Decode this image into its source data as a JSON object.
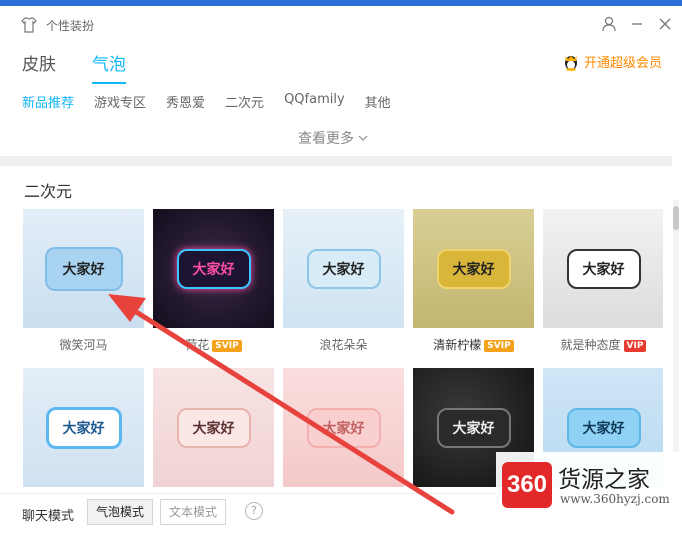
{
  "window": {
    "title": "个性装扮"
  },
  "tabs": [
    {
      "label": "皮肤",
      "active": false
    },
    {
      "label": "气泡",
      "active": true
    }
  ],
  "vip_link": {
    "label": "开通超级会员"
  },
  "subnav": [
    {
      "label": "新品推荐",
      "active": true
    },
    {
      "label": "游戏专区",
      "active": false
    },
    {
      "label": "秀恩爱",
      "active": false
    },
    {
      "label": "二次元",
      "active": false
    },
    {
      "label": "QQfamily",
      "active": false
    },
    {
      "label": "其他",
      "active": false
    }
  ],
  "more_label": "查看更多",
  "section_title": "二次元",
  "bubbles": [
    {
      "text": "大家好",
      "name": "微笑河马",
      "badge": ""
    },
    {
      "text": "大家好",
      "name": "荷花",
      "badge": "SVIP"
    },
    {
      "text": "大家好",
      "name": "浪花朵朵",
      "badge": ""
    },
    {
      "text": "大家好",
      "name": "清新柠檬",
      "badge": "SVIP"
    },
    {
      "text": "大家好",
      "name": "就是种态度",
      "badge": "VIP"
    },
    {
      "text": "大家好",
      "name": "",
      "badge": ""
    },
    {
      "text": "大家好",
      "name": "",
      "badge": ""
    },
    {
      "text": "大家好",
      "name": "",
      "badge": ""
    },
    {
      "text": "大家好",
      "name": "",
      "badge": ""
    },
    {
      "text": "大家好",
      "name": "",
      "badge": ""
    }
  ],
  "footer": {
    "mode_label": "聊天模式",
    "bubble_mode": "气泡模式",
    "text_mode": "文本模式",
    "help": "?"
  },
  "watermark": {
    "logo": "360",
    "title": "货源之家",
    "url": "www.360hyzj.com"
  },
  "colors": {
    "accent": "#12b7f5",
    "vip_orange": "#ff8a00",
    "svip_badge": "#f5a21b",
    "vip_badge": "#e63b2e",
    "annotation_arrow": "#e8423c"
  }
}
